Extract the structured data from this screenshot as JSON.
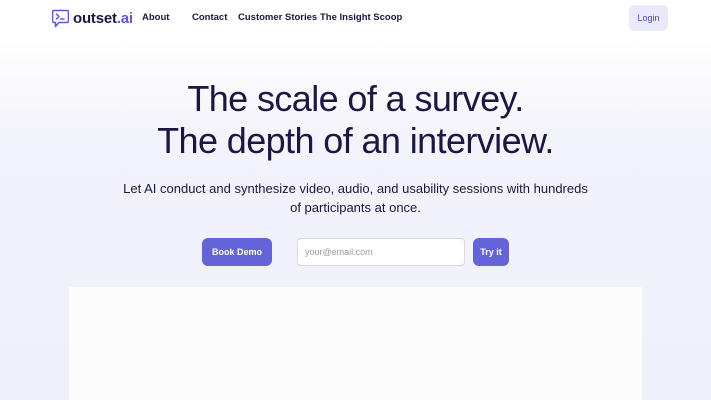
{
  "nav": {
    "logo": {
      "name": "outset",
      "tld": ".ai",
      "icon": "terminal-chat-icon"
    },
    "links": [
      {
        "label": "About"
      },
      {
        "label": "Contact"
      },
      {
        "label": "Customer Stories"
      },
      {
        "label": "The Insight Scoop"
      }
    ],
    "login_label": "Login"
  },
  "hero": {
    "headline_line1": "The scale of a survey.",
    "headline_line2": "The depth of an interview.",
    "subtext": "Let AI conduct and synthesize video, audio, and usability sessions with hundreds of participants at once.",
    "book_demo_label": "Book Demo",
    "email_placeholder": "your@email.com",
    "email_value": "",
    "try_label": "Try it"
  },
  "colors": {
    "brand": "#6464d8",
    "text": "#1b1740",
    "login_bg": "#e9e9fb"
  }
}
